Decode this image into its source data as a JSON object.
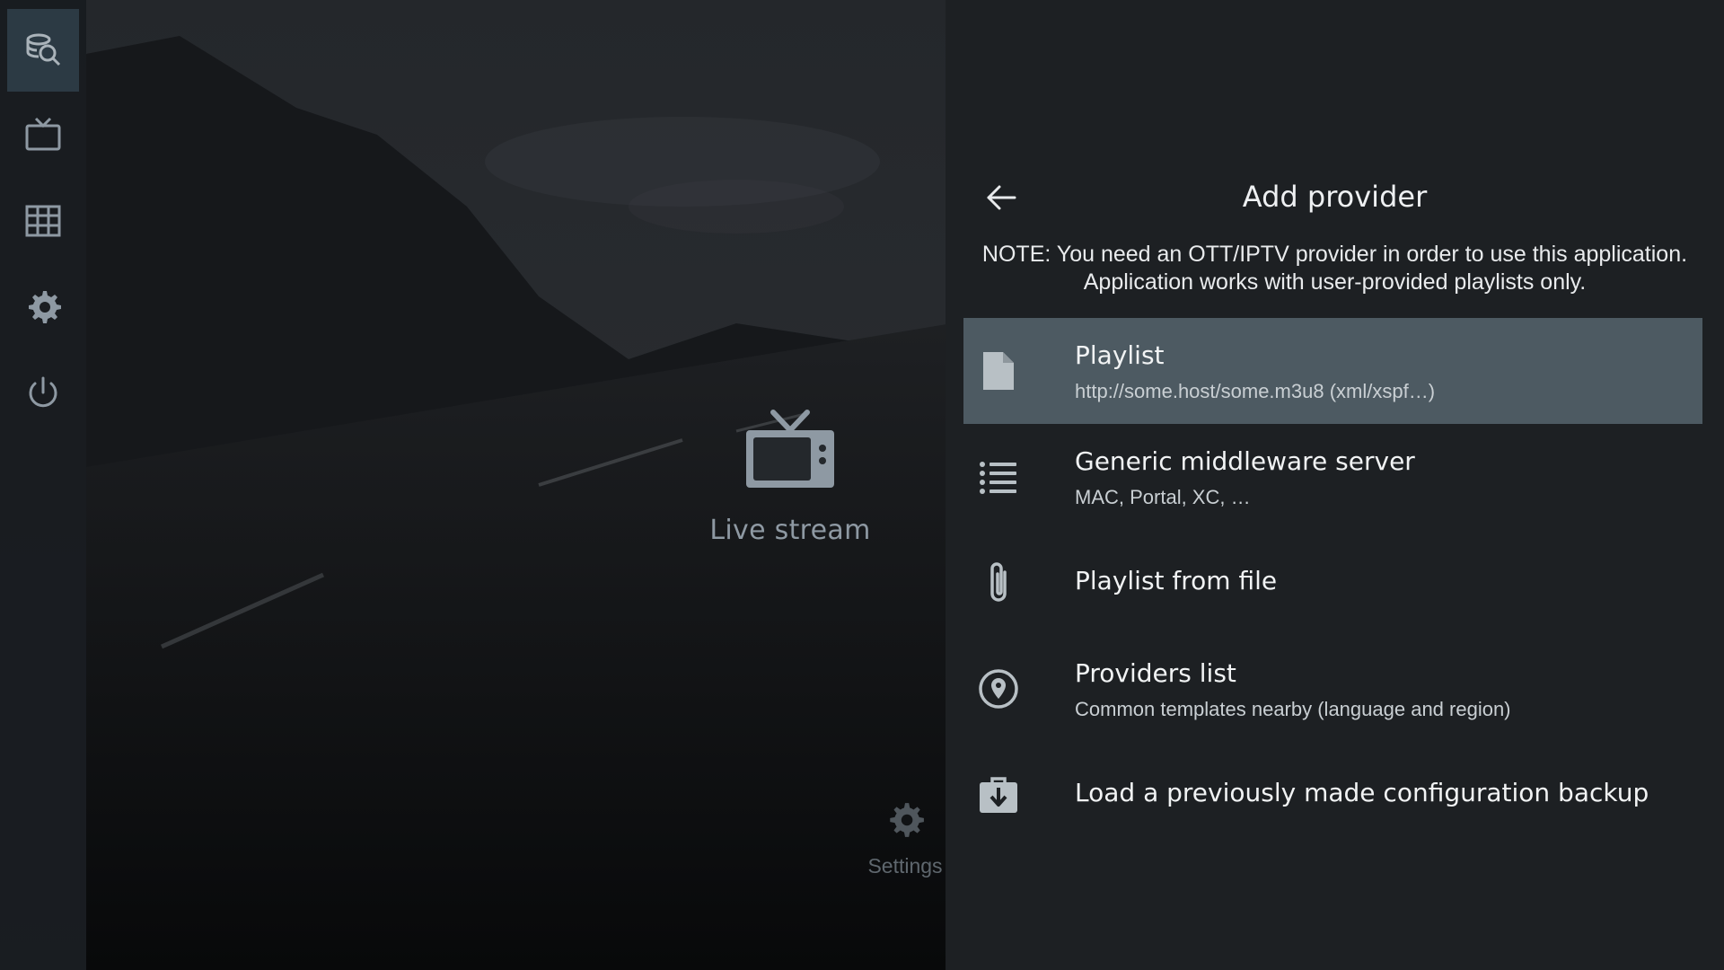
{
  "colors": {
    "panel_bg": "#1d2023",
    "selected_bg": "#4d5a62",
    "rail_active_bg": "#2c3a44",
    "icon_gray": "#8e99a3"
  },
  "rail": {
    "items": [
      {
        "icon": "search-icon",
        "active": true
      },
      {
        "icon": "tv-icon"
      },
      {
        "icon": "grid-icon"
      },
      {
        "icon": "gear-icon"
      },
      {
        "icon": "power-icon"
      }
    ]
  },
  "center": {
    "tile_label": "Live stream",
    "tile_icon": "tv-icon",
    "settings_label": "Settings",
    "settings_icon": "gear-icon"
  },
  "panel": {
    "title": "Add provider",
    "back_icon": "arrow-left-icon",
    "note_line1": "NOTE: You need an OTT/IPTV provider in order to use this application.",
    "note_line2": "Application works with user-provided playlists only.",
    "options": [
      {
        "title": "Playlist",
        "subtitle": "http://some.host/some.m3u8 (xml/xspf…)",
        "icon": "file-icon",
        "selected": true
      },
      {
        "title": "Generic middleware server",
        "subtitle": "MAC, Portal, XC, …",
        "icon": "list-icon"
      },
      {
        "title": "Playlist from file",
        "subtitle": "",
        "icon": "paperclip-icon"
      },
      {
        "title": "Providers list",
        "subtitle": "Common templates nearby (language and region)",
        "icon": "location-icon"
      },
      {
        "title": "Load a previously made configuration backup",
        "subtitle": "",
        "icon": "backup-icon"
      }
    ]
  }
}
